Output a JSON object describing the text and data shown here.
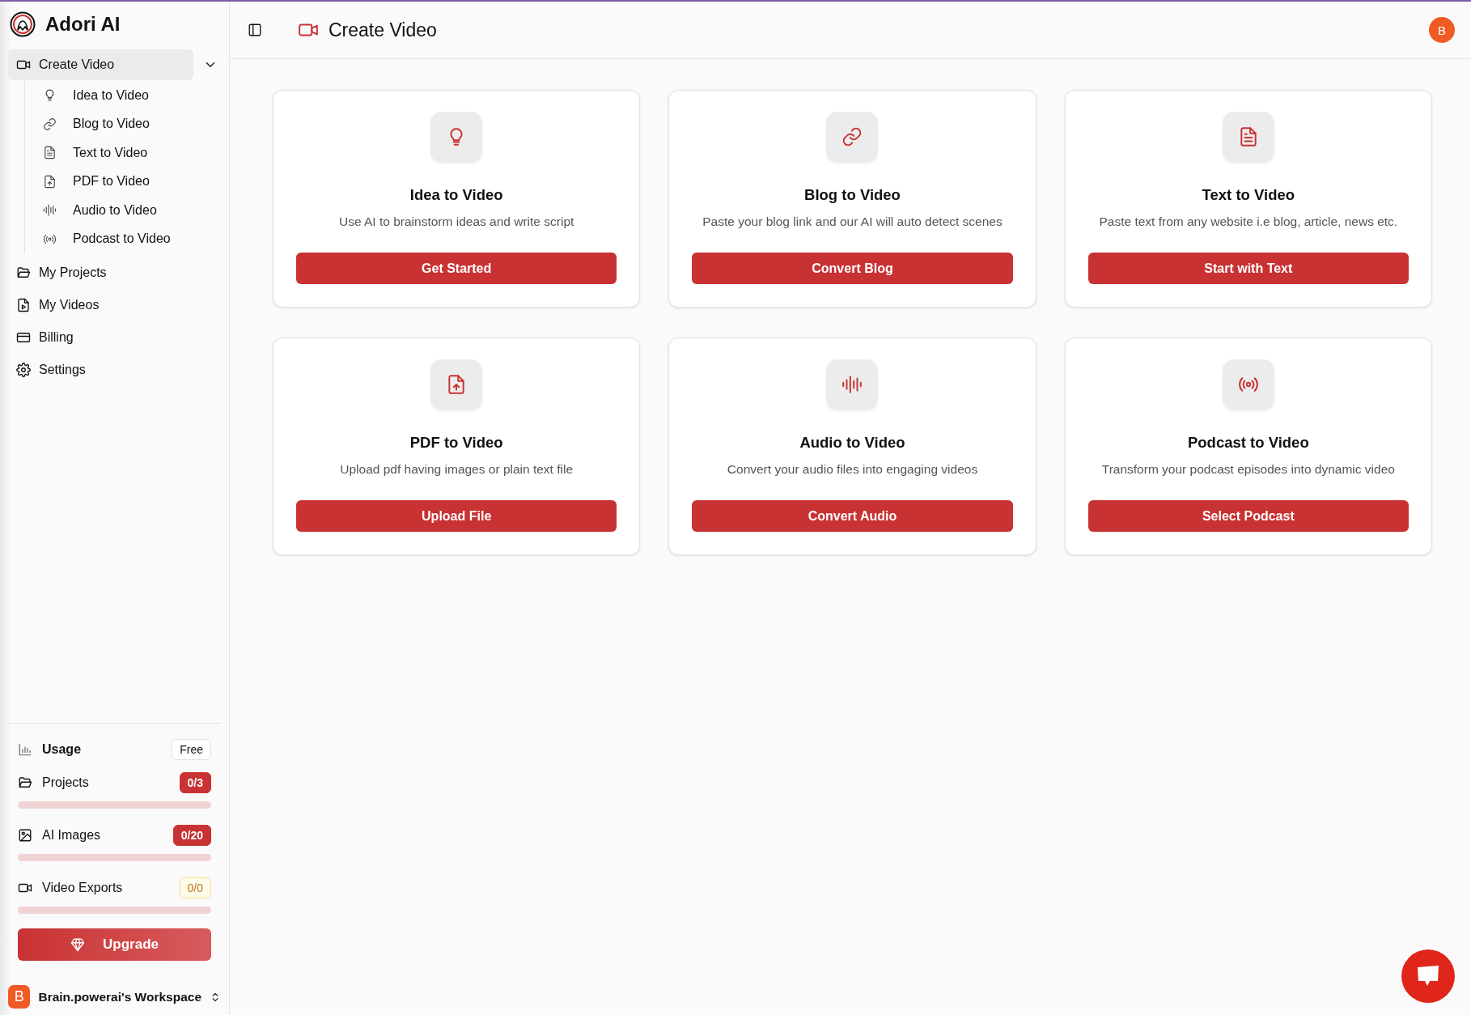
{
  "brand": {
    "name": "Adori AI"
  },
  "nav": [
    {
      "label": "Create Video",
      "selected": true,
      "expanded": true,
      "children": [
        {
          "label": "Idea to Video",
          "selected": false
        },
        {
          "label": "Blog to Video",
          "selected": false
        },
        {
          "label": "Text to Video",
          "selected": false
        },
        {
          "label": "PDF to Video",
          "selected": false
        },
        {
          "label": "Audio to Video",
          "selected": false
        },
        {
          "label": "Podcast to Video",
          "selected": false
        }
      ]
    },
    {
      "label": "My Projects",
      "selected": false
    },
    {
      "label": "My Videos",
      "selected": false
    },
    {
      "label": "Billing",
      "selected": false
    },
    {
      "label": "Settings",
      "selected": false
    }
  ],
  "usage": {
    "title": "Usage",
    "plan": "Free",
    "items": [
      {
        "label": "Projects",
        "count": "0/3",
        "kind": "danger"
      },
      {
        "label": "AI Images",
        "count": "0/20",
        "kind": "danger"
      },
      {
        "label": "Video Exports",
        "count": "0/0",
        "kind": "warning"
      }
    ],
    "upgrade": "Upgrade"
  },
  "workspace": {
    "avatar": "B",
    "name": "Brain.powerai's Workspace"
  },
  "header": {
    "title": "Create Video",
    "avatar": "B"
  },
  "cards": [
    {
      "title": "Idea to Video",
      "description": "Use AI to brainstorm ideas and write script",
      "button": "Get Started"
    },
    {
      "title": "Blog to Video",
      "description": "Paste your blog link and our AI will auto detect scenes",
      "button": "Convert Blog"
    },
    {
      "title": "Text to Video",
      "description": "Paste text from any website i.e blog, article, news etc.",
      "button": "Start with Text"
    },
    {
      "title": "PDF to Video",
      "description": "Upload pdf having images or plain text file",
      "button": "Upload File"
    },
    {
      "title": "Audio to Video",
      "description": "Convert your audio files into engaging videos",
      "button": "Convert Audio"
    },
    {
      "title": "Podcast to Video",
      "description": "Transform your podcast episodes into dynamic video",
      "button": "Select Podcast"
    }
  ]
}
